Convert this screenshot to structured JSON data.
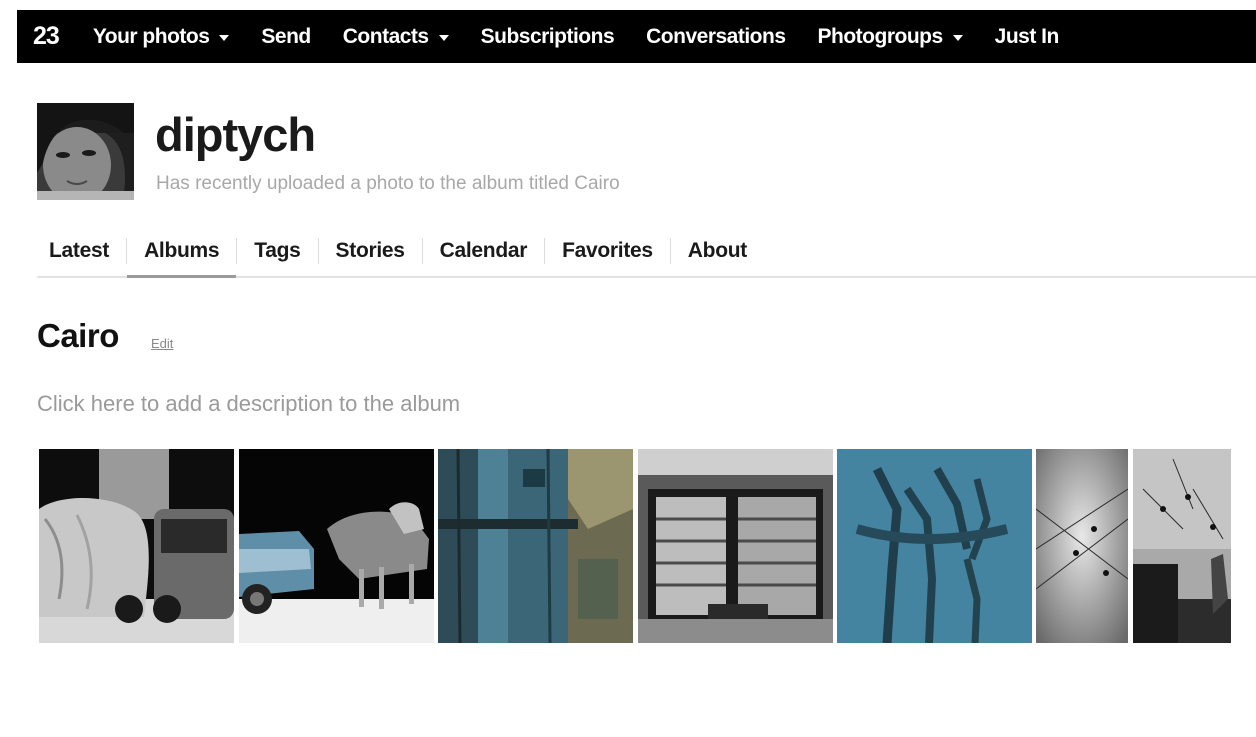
{
  "topbar": {
    "logo": "23",
    "items": [
      {
        "label": "Your photos",
        "dropdown": true
      },
      {
        "label": "Send",
        "dropdown": false
      },
      {
        "label": "Contacts",
        "dropdown": true
      },
      {
        "label": "Subscriptions",
        "dropdown": false
      },
      {
        "label": "Conversations",
        "dropdown": false
      },
      {
        "label": "Photogroups",
        "dropdown": true
      },
      {
        "label": "Just In",
        "dropdown": false
      }
    ]
  },
  "profile": {
    "username": "diptych",
    "status": "Has recently uploaded a photo to the album titled Cairo"
  },
  "tabs": [
    {
      "label": "Latest",
      "active": false
    },
    {
      "label": "Albums",
      "active": true
    },
    {
      "label": "Tags",
      "active": false
    },
    {
      "label": "Stories",
      "active": false
    },
    {
      "label": "Calendar",
      "active": false
    },
    {
      "label": "Favorites",
      "active": false
    },
    {
      "label": "About",
      "active": false
    }
  ],
  "album": {
    "title": "Cairo",
    "edit_label": "Edit",
    "description_placeholder": "Click here to add a description to the album"
  },
  "colors": {
    "topbar_bg": "#000000",
    "topbar_text": "#ffffff",
    "muted_text": "#a8a8a8"
  }
}
